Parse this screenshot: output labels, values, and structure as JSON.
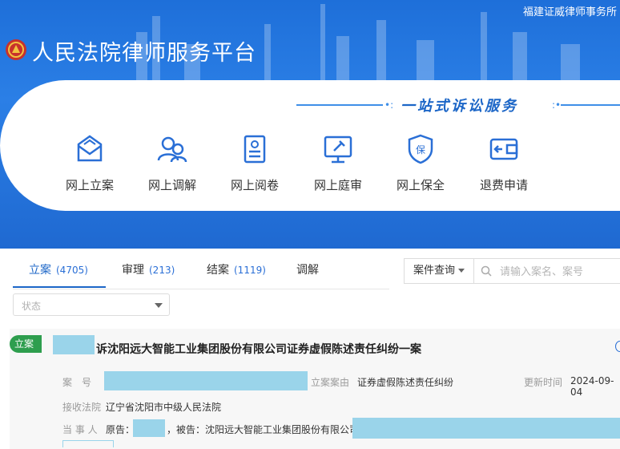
{
  "header": {
    "firm_name": "福建证威律师事务所",
    "platform_title": "人民法院律师服务平台",
    "slogan": "一站式诉讼服务"
  },
  "services": [
    {
      "label": "网上立案",
      "icon": "envelope-icon"
    },
    {
      "label": "网上调解",
      "icon": "people-icon"
    },
    {
      "label": "网上阅卷",
      "icon": "document-icon"
    },
    {
      "label": "网上庭审",
      "icon": "court-screen-icon"
    },
    {
      "label": "网上保全",
      "icon": "shield-icon"
    },
    {
      "label": "退费申请",
      "icon": "wallet-icon"
    }
  ],
  "tabs": [
    {
      "label": "立案",
      "count": "(4705)",
      "active": true
    },
    {
      "label": "审理",
      "count": "(213)",
      "active": false
    },
    {
      "label": "结案",
      "count": "(1119)",
      "active": false
    },
    {
      "label": "调解",
      "count": "",
      "active": false
    }
  ],
  "filters": {
    "status_placeholder": "状态",
    "case_query_label": "案件查询",
    "search_placeholder": "请输入案名、案号"
  },
  "case": {
    "tag": "立案",
    "title": "诉沈阳远大智能工业集团股份有限公司证券虚假陈述责任纠纷一案",
    "case_no_label": "案　号",
    "cause_label": "立案案由",
    "cause_value": "证券虚假陈述责任纠纷",
    "updated_label": "更新时间",
    "updated_value": "2024-09-04",
    "court_label": "接收法院",
    "court_value": "辽宁省沈阳市中级人民法院",
    "parties_label": "当 事 人",
    "parties_plaintiff": "原告：",
    "parties_defendant": "，被告：沈阳远大智能工业集团股份有限公司"
  },
  "colors": {
    "brand_blue": "#1e6fd9",
    "accent": "#1c66c7",
    "tag_green": "#2e9e4e",
    "redaction": "#9ad4ea"
  }
}
